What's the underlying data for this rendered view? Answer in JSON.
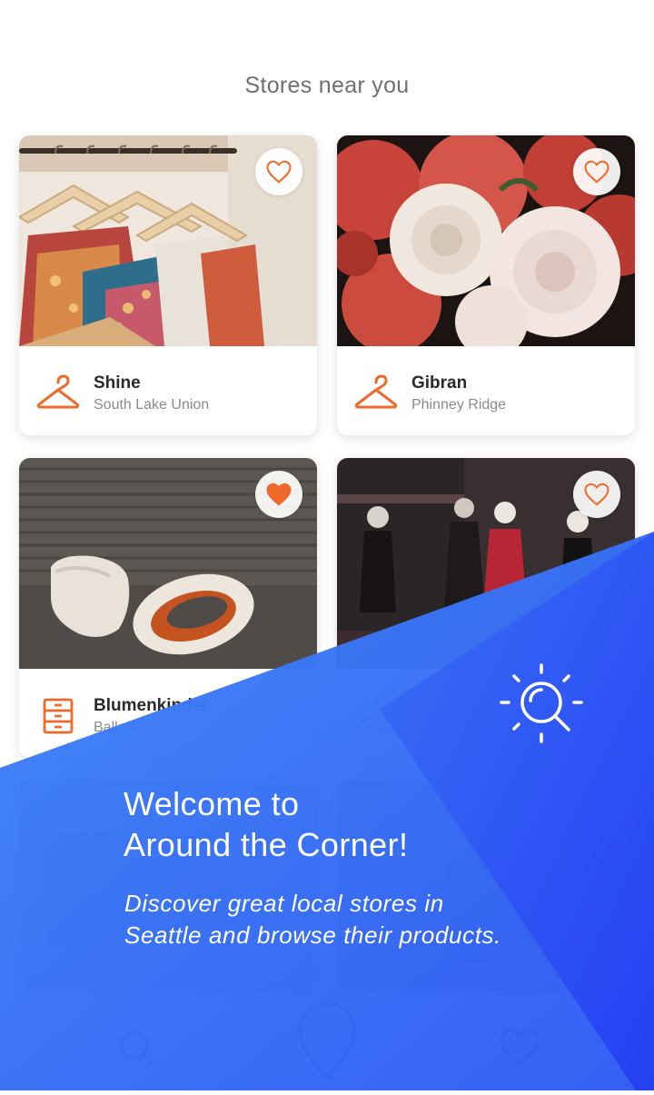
{
  "header": {
    "title": "Stores near you"
  },
  "stores": [
    {
      "name": "Shine",
      "area": "South Lake Union",
      "category_icon": "hanger-icon",
      "favorited": false,
      "photo": "clothing-rack-photo"
    },
    {
      "name": "Gibran",
      "area": "Phinney Ridge",
      "category_icon": "hanger-icon",
      "favorited": false,
      "photo": "roses-photo"
    },
    {
      "name": "Blumenkinder",
      "area": "Ballard",
      "category_icon": "dresser-icon",
      "favorited": true,
      "photo": "chairs-photo"
    },
    {
      "name": "",
      "area": "",
      "category_icon": "hanger-icon",
      "favorited": false,
      "photo": "mannequins-photo"
    }
  ],
  "onboarding": {
    "title": "Welcome to Around the Corner!",
    "title_line1": "Welcome to",
    "title_line2": "Around the Corner!",
    "tagline": "Discover great local stores in Seattle and browse their products.",
    "icon": "search-icon"
  },
  "colors": {
    "accent": "#ef6a2a",
    "overlay_start": "#3d7ff7",
    "overlay_end": "#2747f2",
    "title_gray": "#6f6f6f"
  },
  "bottom_nav": {
    "icons": [
      "search-icon",
      "map-pin-icon",
      "heart-icon"
    ]
  }
}
